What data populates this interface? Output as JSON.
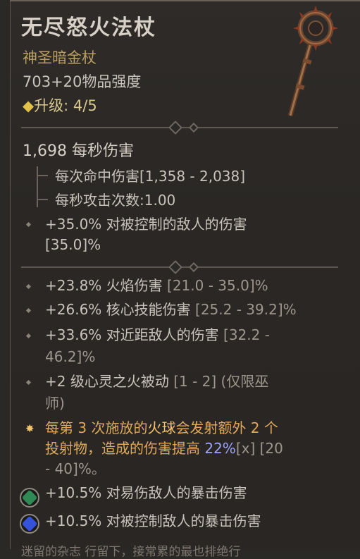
{
  "item": {
    "name": "无尽怒火法杖",
    "type": "神圣暗金杖",
    "power": "703+20物品强度",
    "upgrade_icon": "◆",
    "upgrade": "升级: 4/5",
    "dps": "1,698 每秒伤害",
    "damage_per_hit": "每次命中伤害[1,358 - 2,038]",
    "attacks_per_second": "每秒攻击次数:1.00"
  },
  "implicit": {
    "value": "+35.0% 对被控制的敌人的伤害",
    "range": "[35.0]%"
  },
  "affixes": [
    {
      "text": "+23.8% 火焰伤害 ",
      "range": "[21.0 - 35.0]%"
    },
    {
      "text": "+26.6% 核心技能伤害 ",
      "range": "[25.2 - 39.2]%"
    },
    {
      "text": "+33.6% 对近距敌人的伤害 ",
      "range": "[32.2 -"
    },
    {
      "text": "",
      "range": "46.2]%"
    },
    {
      "text": "+2 级心灵之火被动 ",
      "range": "[1 - 2] (仅限巫"
    },
    {
      "text": "",
      "range": "师)"
    }
  ],
  "legendary": {
    "line1_a": "每第 3 次施放的",
    "line1_b": "火球",
    "line1_c": "会发射额外 2 个",
    "line2_a": "投射物，造成的伤害提高 ",
    "line2_b": "22%",
    "line2_c": "[x]",
    "line2_d": " [20",
    "line3": "- 40]%。"
  },
  "sockets": [
    {
      "icon": "emerald-gem-icon",
      "color": "#2f8a55",
      "text": "+10.5% 对易伤敌人的暴击伤害"
    },
    {
      "icon": "sapphire-gem-icon",
      "color": "#3553d8",
      "text": "+10.5% 对被控制敌人的暴击伤害"
    }
  ],
  "footer": "迷留的杂志 行留下，接常累的最也排绝行"
}
